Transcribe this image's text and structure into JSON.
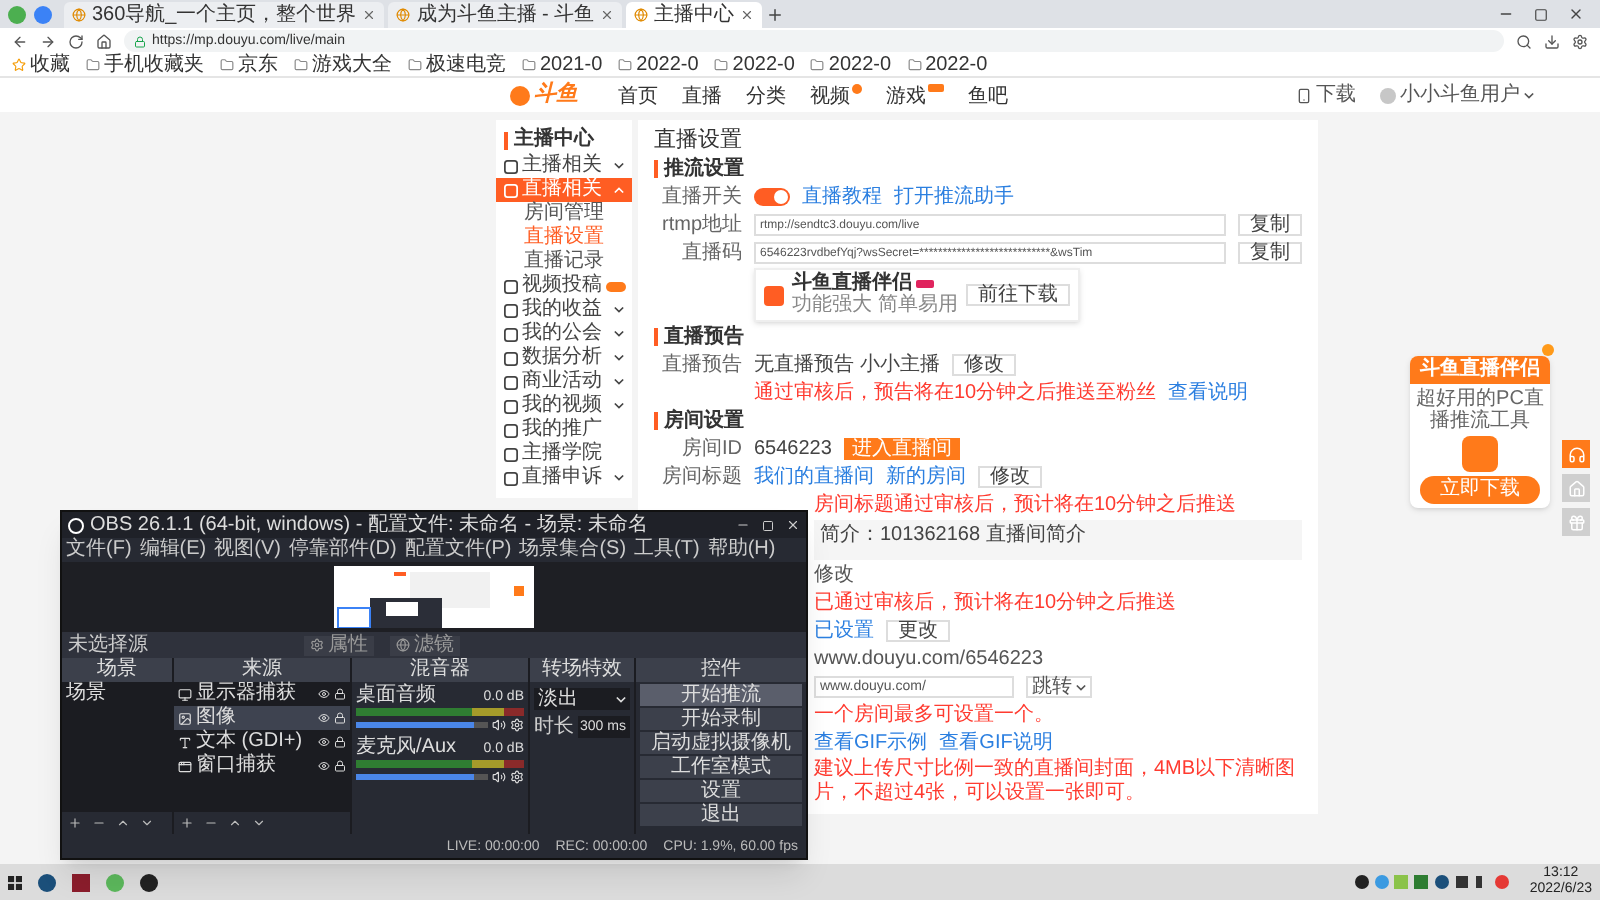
{
  "browser": {
    "tabs": [
      {
        "label": "360导航_一个主页，整个世界",
        "selected": false
      },
      {
        "label": "成为斗鱼主播 - 斗鱼",
        "selected": false
      },
      {
        "label": "主播中心",
        "selected": true
      }
    ],
    "url": "https://mp.douyu.com/live/main",
    "bookmarks": [
      "收藏",
      "手机收藏夹",
      "京东",
      "游戏大全",
      "极速电竞",
      "2021-0",
      "2022-0",
      "2022-0",
      "2022-0",
      "2022-0"
    ]
  },
  "site_nav": {
    "logo": "斗鱼",
    "items": [
      {
        "label": "首页",
        "dot": false,
        "tag": false
      },
      {
        "label": "直播",
        "dot": false,
        "tag": false
      },
      {
        "label": "分类",
        "dot": false,
        "tag": false
      },
      {
        "label": "视频",
        "dot": true,
        "tag": false
      },
      {
        "label": "游戏",
        "dot": false,
        "tag": true
      },
      {
        "label": "鱼吧",
        "dot": false,
        "tag": false
      }
    ],
    "download": "下载",
    "user": "小小斗鱼用户"
  },
  "sidebar": {
    "title": "主播中心",
    "items": [
      {
        "label": "主播相关",
        "kind": "group",
        "expanded": false,
        "selected": false,
        "badge": false
      },
      {
        "label": "直播相关",
        "kind": "group",
        "expanded": true,
        "selected": true,
        "badge": false,
        "children": [
          {
            "label": "房间管理",
            "selected": false
          },
          {
            "label": "直播设置",
            "selected": true
          },
          {
            "label": "直播记录",
            "selected": false
          }
        ]
      },
      {
        "label": "视频投稿",
        "kind": "link",
        "selected": false,
        "badge": true
      },
      {
        "label": "我的收益",
        "kind": "group",
        "expanded": false,
        "selected": false,
        "badge": false
      },
      {
        "label": "我的公会",
        "kind": "group",
        "expanded": false,
        "selected": false,
        "badge": false
      },
      {
        "label": "数据分析",
        "kind": "group",
        "expanded": false,
        "selected": false,
        "badge": false
      },
      {
        "label": "商业活动",
        "kind": "group",
        "expanded": false,
        "selected": false,
        "badge": false
      },
      {
        "label": "我的视频",
        "kind": "group",
        "expanded": false,
        "selected": false,
        "badge": false
      },
      {
        "label": "我的推广",
        "kind": "link",
        "selected": false,
        "badge": false
      },
      {
        "label": "主播学院",
        "kind": "link",
        "selected": false,
        "badge": false
      },
      {
        "label": "直播申诉",
        "kind": "group",
        "expanded": false,
        "selected": false,
        "badge": false
      }
    ]
  },
  "main": {
    "title": "直播设置",
    "sections": [
      {
        "title": "推流设置",
        "rows": [
          {
            "kind": "toggle",
            "label": "直播开关",
            "on": true,
            "links": [
              "直播教程",
              "打开推流助手"
            ]
          },
          {
            "kind": "field",
            "label": "rtmp地址",
            "value": "rtmp://sendtc3.douyu.com/live",
            "button": "复制"
          },
          {
            "kind": "field",
            "label": "直播码",
            "value": "6546223rvdbefYqj?wsSecret=****************************&wsTim",
            "button": "复制"
          },
          {
            "kind": "promo",
            "name": "斗鱼直播伴侣",
            "desc": "功能强大 简单易用",
            "button": "前往下载"
          }
        ]
      },
      {
        "title": "直播预告",
        "rows": [
          {
            "kind": "text",
            "label": "直播预告",
            "value": "无直播预告 小小主播",
            "button": "修改"
          },
          {
            "kind": "note",
            "text": "通过审核后，预告将在10分钟之后推送至粉丝",
            "link": "查看说明"
          }
        ]
      },
      {
        "title": "房间设置",
        "rows": [
          {
            "kind": "id",
            "label": "房间ID",
            "value": "6546223",
            "button": "进入直播间"
          },
          {
            "kind": "links",
            "label": "房间标题",
            "links": [
              "我们的直播间",
              "新的房间"
            ],
            "button": "修改"
          },
          {
            "kind": "note",
            "text": "房间标题通过审核后，预计将在10分钟之后推送"
          },
          {
            "kind": "box",
            "text": "简介：101362168 直播间简介"
          },
          {
            "kind": "plain",
            "text": "修改"
          },
          {
            "kind": "note",
            "text": "已通过审核后，预计将在10分钟之后推送"
          },
          {
            "kind": "linkbutton",
            "link": "已设置",
            "button": "更改"
          },
          {
            "kind": "plain",
            "text": "www.douyu.com/6546223"
          },
          {
            "kind": "select",
            "value": "www.douyu.com/",
            "option": "跳转"
          },
          {
            "kind": "note",
            "text": "一个房间最多可设置一个。"
          },
          {
            "kind": "links",
            "links": [
              "查看GIF示例",
              "查看GIF说明"
            ]
          },
          {
            "kind": "note",
            "text": "建议上传尺寸比例一致的直播间封面，4MB以下清晰图片，不超过4张，可以设置一张即可。"
          }
        ]
      }
    ]
  },
  "obs": {
    "title": "OBS 26.1.1 (64-bit, windows) - 配置文件: 未命名 - 场景: 未命名",
    "menu": [
      "文件(F)",
      "编辑(E)",
      "视图(V)",
      "停靠部件(D)",
      "配置文件(P)",
      "场景集合(S)",
      "工具(T)",
      "帮助(H)"
    ],
    "source_bar": "未选择源",
    "source_buttons": [
      "属性",
      "滤镜"
    ],
    "scenes": {
      "title": "场景",
      "items": [
        {
          "label": "场景",
          "selected": false
        }
      ]
    },
    "sources": {
      "title": "来源",
      "items": [
        {
          "label": "显示器捕获",
          "kind": "monitor",
          "selected": false
        },
        {
          "label": "图像",
          "kind": "image",
          "selected": true
        },
        {
          "label": "文本 (GDI+)",
          "kind": "text",
          "selected": false
        },
        {
          "label": "窗口捕获",
          "kind": "window",
          "selected": false
        }
      ]
    },
    "mixer": {
      "title": "混音器",
      "channels": [
        {
          "name": "桌面音频",
          "reading": "0.0 dB",
          "level": 0.9
        },
        {
          "name": "麦克风/Aux",
          "reading": "0.0 dB",
          "level": 0.9
        }
      ]
    },
    "transitions": {
      "title": "转场特效",
      "value": "淡出",
      "duration_label": "时长",
      "duration": "300 ms"
    },
    "controls": {
      "title": "控件",
      "buttons": [
        "开始推流",
        "开始录制",
        "启动虚拟摄像机",
        "工作室模式",
        "设置",
        "退出"
      ]
    },
    "status": [
      "LIVE: 00:00:00",
      "REC: 00:00:00",
      "CPU: 1.9%, 60.00 fps"
    ]
  },
  "ad": {
    "title": "斗鱼直播伴侣",
    "desc": "超好用的PC直播推流工具",
    "button": "立即下载"
  },
  "taskbar": {
    "time": "13:12",
    "date": "2022/6/23"
  }
}
